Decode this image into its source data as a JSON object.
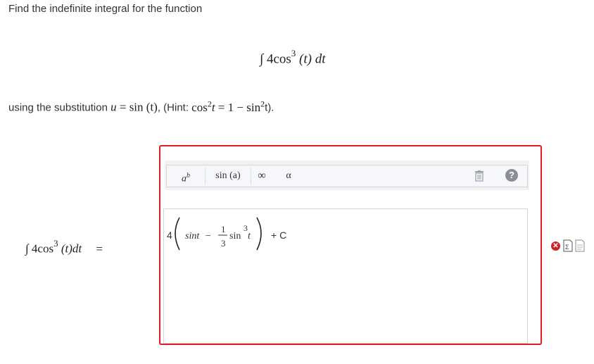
{
  "prompt": {
    "text": "Find the indefinite integral for the function"
  },
  "integral": {
    "integral_sign": "∫",
    "coefficient": "4cos",
    "power": "3",
    "argument": " (t) dt"
  },
  "hint": {
    "prefix": "using the substitution ",
    "u_var": "u",
    "eq": " = ",
    "u_value": "sin (t)",
    "hint_open": ", (Hint: ",
    "cos_part": "cos",
    "cos_pow": "2",
    "t_var": "t",
    "hint_eq": "  =  1 − sin",
    "sin_pow": "2",
    "hint_close": "t)."
  },
  "left_integral": {
    "integral_sign": "∫",
    "coefficient": "4cos",
    "power": "3",
    "argument": " (t)dt",
    "equals": "="
  },
  "toolbar": {
    "exponent_base": "a",
    "exponent_sup": "b",
    "sin_label": "sin (a)",
    "infinity_label": "∞",
    "alpha_label": "α",
    "help_label": "?"
  },
  "answer": {
    "coefficient": "4",
    "sint": "sint",
    "minus": "−",
    "frac_num": "1",
    "frac_den": "3",
    "sin": "sin",
    "sin_pow": "3",
    "t": "t",
    "plus_c": "+ C"
  },
  "status": {
    "result": "incorrect",
    "mark": "✕"
  },
  "colors": {
    "answer_border": "#e01b24",
    "incorrect_icon": "#c9242b"
  }
}
